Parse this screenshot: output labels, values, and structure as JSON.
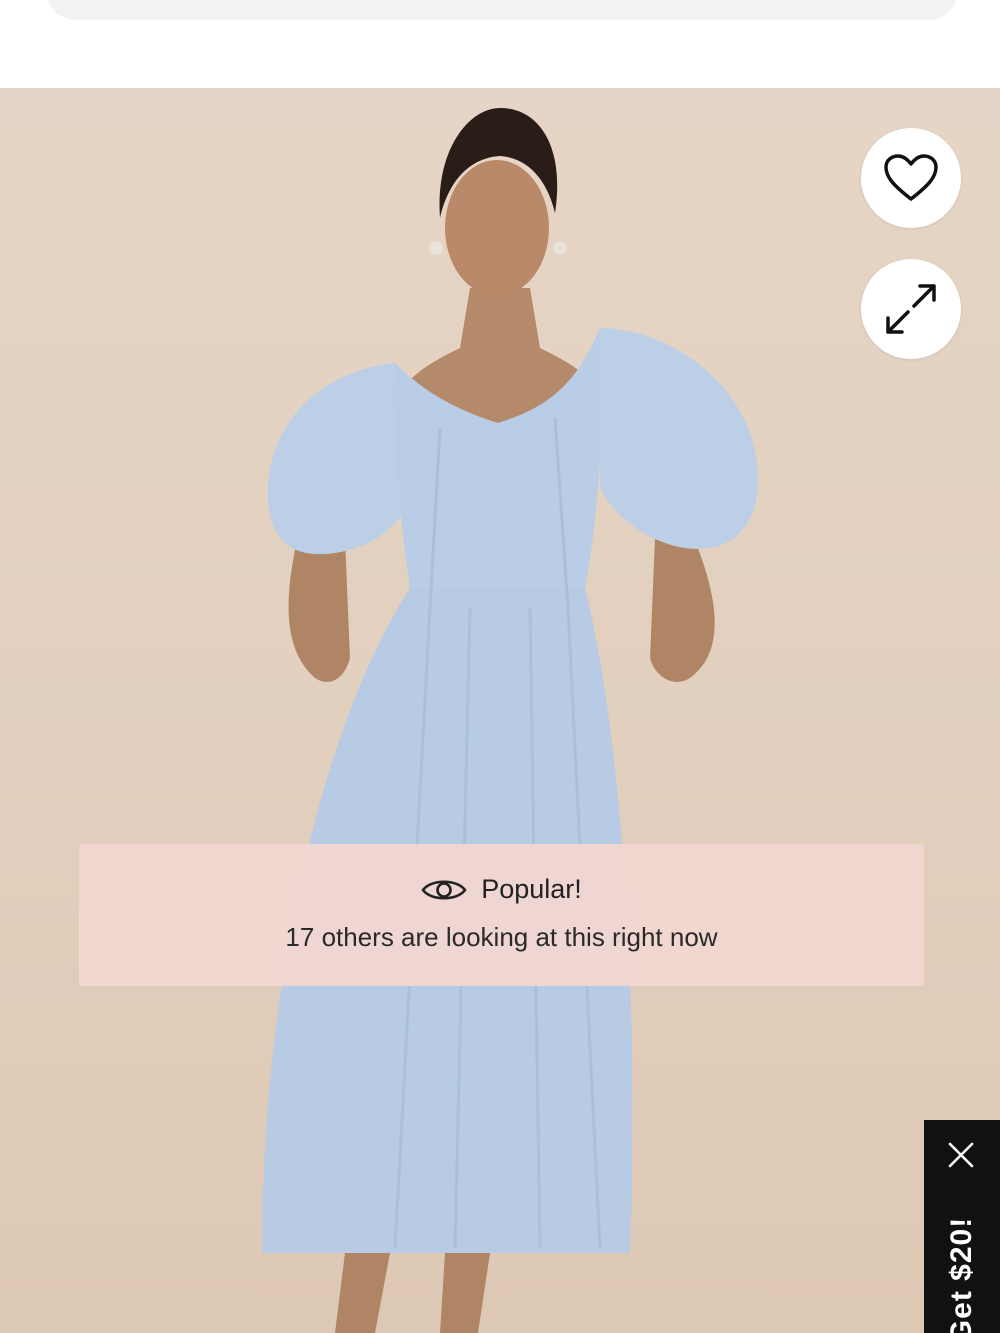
{
  "popular_banner": {
    "title": "Popular!",
    "subtitle": "17 others are looking at this right now",
    "icon": "eye-icon"
  },
  "product_image": {
    "actions": [
      {
        "name": "wishlist",
        "icon": "heart-icon"
      },
      {
        "name": "expand",
        "icon": "expand-arrows-icon"
      }
    ]
  },
  "promo_tab": {
    "label": "Get $20!",
    "close_icon": "close-icon"
  },
  "colors": {
    "backdrop": "#e4d2c2",
    "dress": "#b9cde6",
    "banner_bg": "#f3d6d2",
    "promo_bg": "#111111"
  }
}
